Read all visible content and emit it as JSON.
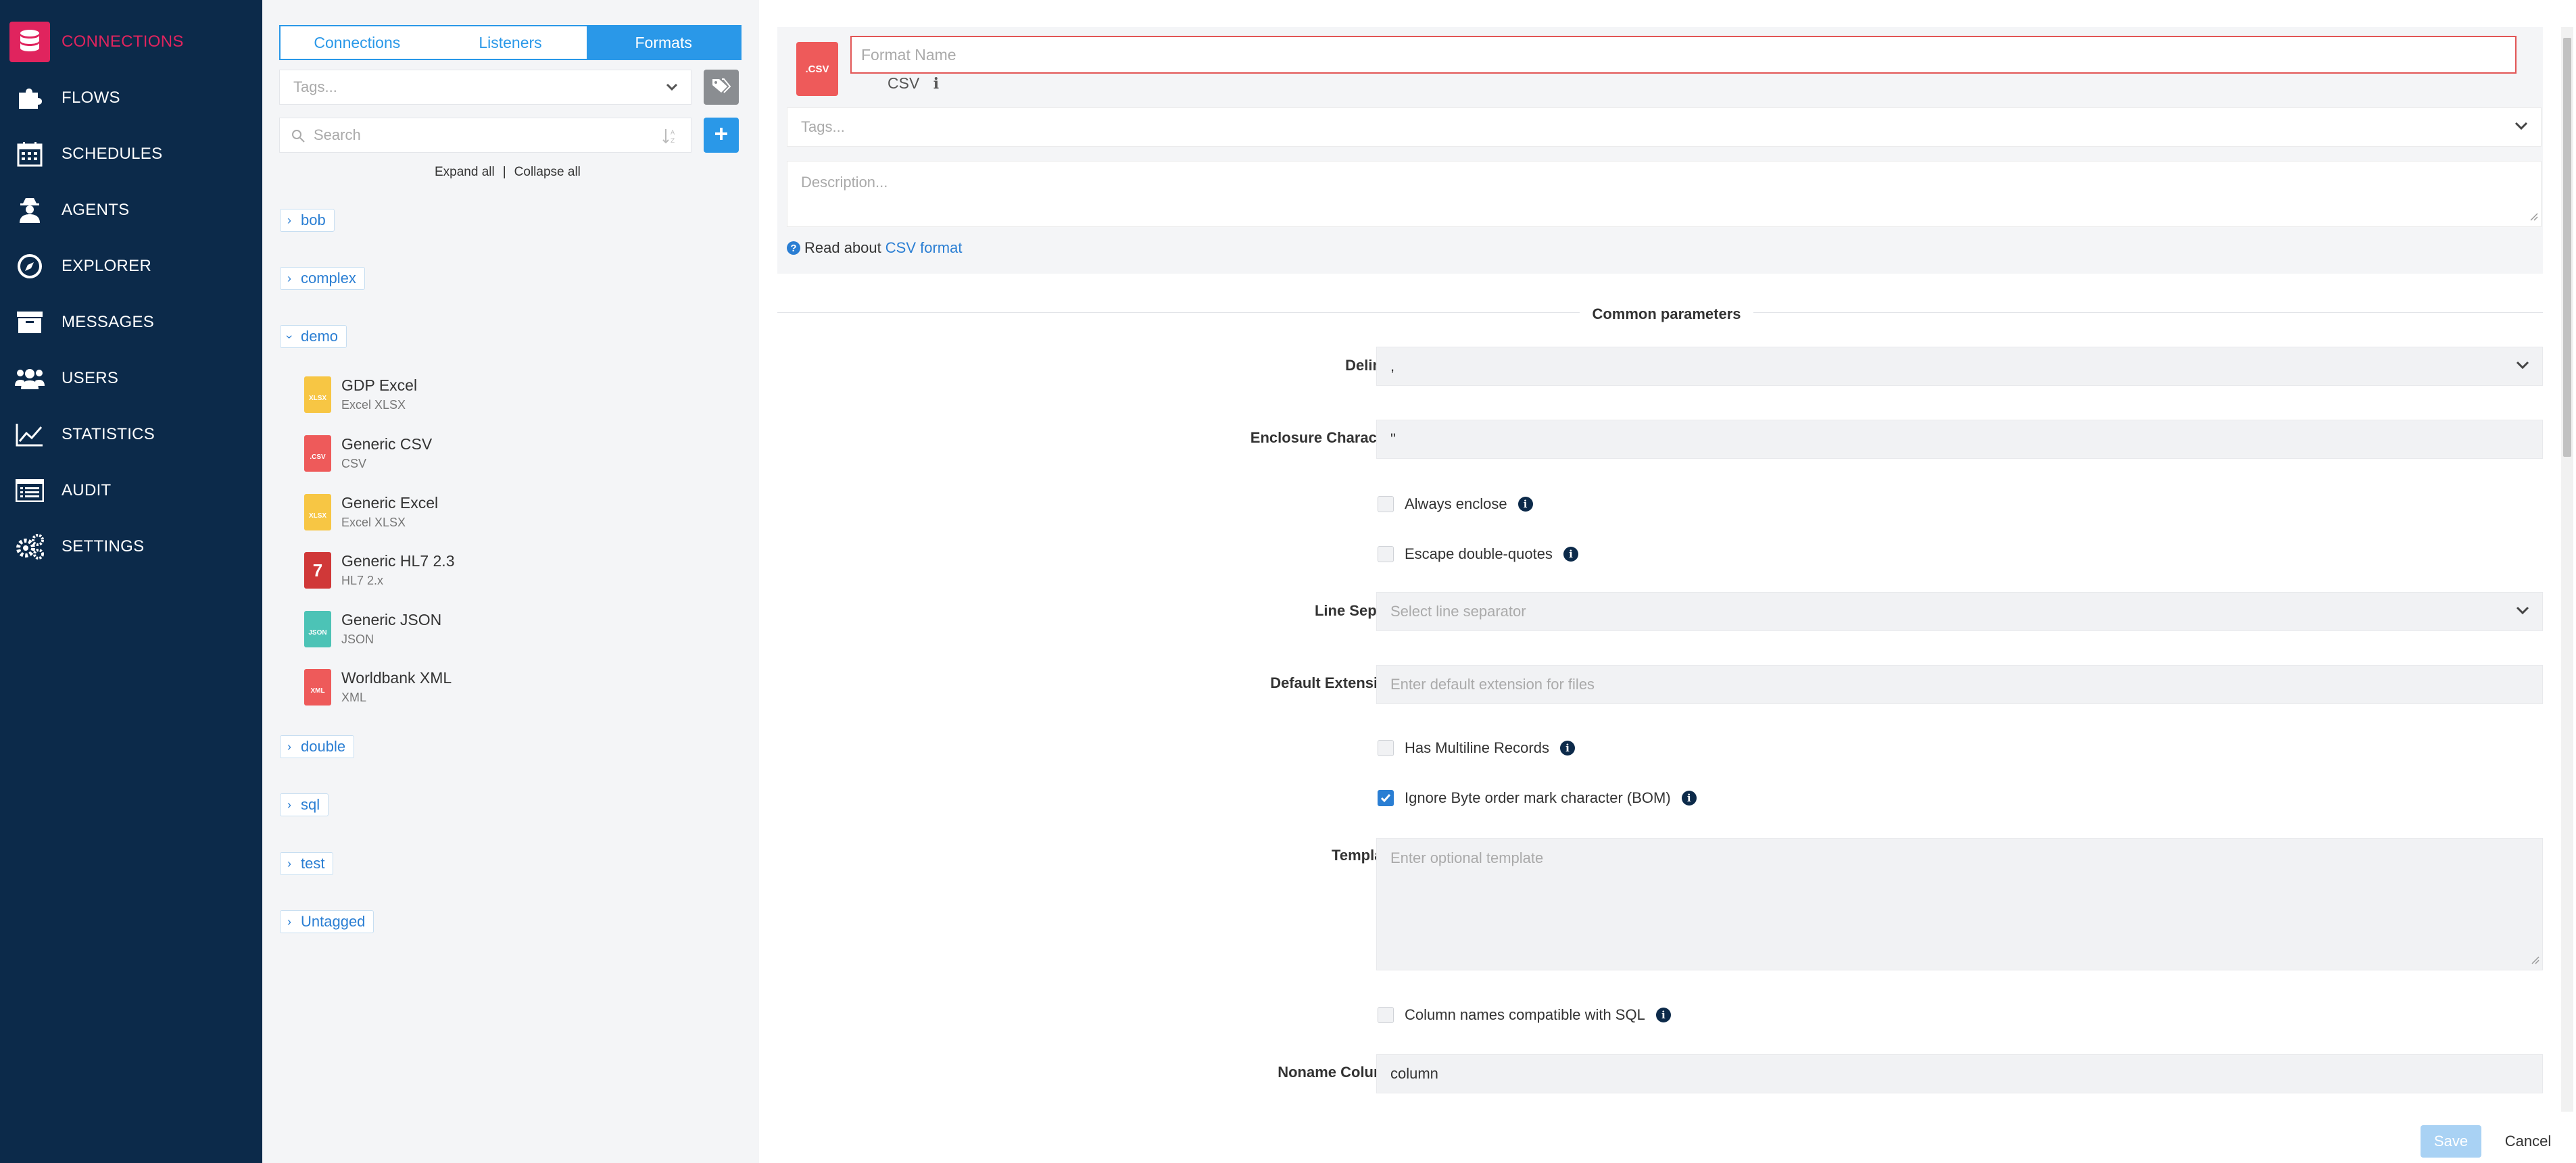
{
  "nav": {
    "items": [
      {
        "label": "CONNECTIONS",
        "icon": "database-icon"
      },
      {
        "label": "FLOWS",
        "icon": "puzzle-icon"
      },
      {
        "label": "SCHEDULES",
        "icon": "calendar-icon"
      },
      {
        "label": "AGENTS",
        "icon": "agent-icon"
      },
      {
        "label": "EXPLORER",
        "icon": "compass-icon"
      },
      {
        "label": "MESSAGES",
        "icon": "archive-icon"
      },
      {
        "label": "USERS",
        "icon": "users-icon"
      },
      {
        "label": "STATISTICS",
        "icon": "chart-line-icon"
      },
      {
        "label": "AUDIT",
        "icon": "list-icon"
      },
      {
        "label": "SETTINGS",
        "icon": "gears-icon"
      }
    ],
    "active": "CONNECTIONS",
    "active_color": "#e0245e"
  },
  "tabs": [
    {
      "label": "Connections"
    },
    {
      "label": "Listeners"
    },
    {
      "label": "Formats"
    }
  ],
  "active_tab": "Formats",
  "filters": {
    "tags_placeholder": "Tags...",
    "search_placeholder": "Search",
    "expand_all": "Expand all",
    "separator": "|",
    "collapse_all": "Collapse all"
  },
  "folders": [
    {
      "label": "bob",
      "expanded": false
    },
    {
      "label": "complex",
      "expanded": false
    },
    {
      "label": "demo",
      "expanded": true
    },
    {
      "label": "double",
      "expanded": false
    },
    {
      "label": "sql",
      "expanded": false
    },
    {
      "label": "test",
      "expanded": false
    },
    {
      "label": "Untagged",
      "expanded": false
    }
  ],
  "demo_items": [
    {
      "title": "GDP Excel",
      "subtitle": "Excel XLSX",
      "badge": "XLSX",
      "color": "#f7c644"
    },
    {
      "title": "Generic CSV",
      "subtitle": "CSV",
      "badge": ".CSV",
      "color": "#ee5a5a"
    },
    {
      "title": "Generic Excel",
      "subtitle": "Excel XLSX",
      "badge": "XLSX",
      "color": "#f7c644"
    },
    {
      "title": "Generic HL7 2.3",
      "subtitle": "HL7 2.x",
      "badge": "7",
      "color": "#d03838"
    },
    {
      "title": "Generic JSON",
      "subtitle": "JSON",
      "badge": "JSON",
      "color": "#4cc3b6"
    },
    {
      "title": "Worldbank XML",
      "subtitle": "XML",
      "badge": "XML",
      "color": "#ee5a5a"
    }
  ],
  "editor": {
    "icon_badge": ".CSV",
    "name_placeholder": "Format Name",
    "format_type": "CSV",
    "tags_placeholder": "Tags...",
    "description_placeholder": "Description...",
    "read_about_prefix": "Read about",
    "read_about_link": "CSV format",
    "section_title": "Common parameters",
    "delimiter_label": "Delimiter *",
    "delimiter_value": ",",
    "enclosure_label": "Enclosure Character",
    "enclosure_value": "\"",
    "always_enclose_label": "Always enclose",
    "always_enclose_checked": false,
    "escape_label": "Escape double-quotes",
    "escape_checked": false,
    "line_sep_label": "Line Separator",
    "line_sep_placeholder": "Select line separator",
    "default_ext_label": "Default Extension",
    "default_ext_placeholder": "Enter default extension for files",
    "multiline_label": "Has Multiline Records",
    "multiline_checked": false,
    "bom_label": "Ignore Byte order mark character (BOM)",
    "bom_checked": true,
    "template_label": "Template",
    "template_placeholder": "Enter optional template",
    "sql_compat_label": "Column names compatible with SQL",
    "sql_compat_checked": false,
    "noname_label": "Noname Column",
    "noname_value": "column",
    "save_label": "Save",
    "cancel_label": "Cancel"
  },
  "colors": {
    "nav_bg": "#0c2a4a",
    "accent_blue": "#2a98e8",
    "error_red": "#e25656"
  }
}
